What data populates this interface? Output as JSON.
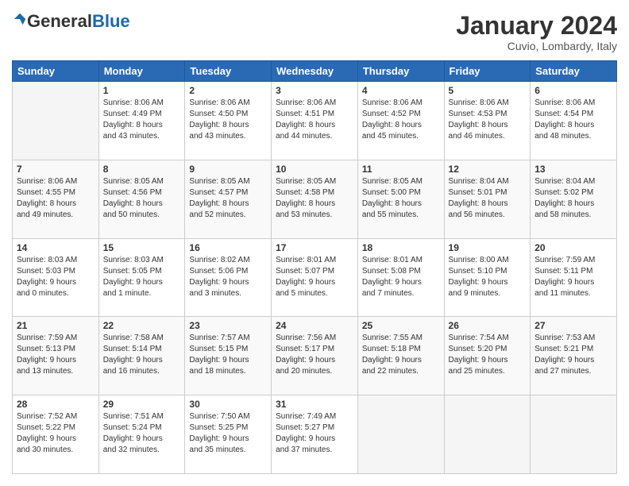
{
  "header": {
    "logo": {
      "general": "General",
      "blue": "Blue"
    },
    "title": "January 2024",
    "location": "Cuvio, Lombardy, Italy"
  },
  "calendar": {
    "headers": [
      "Sunday",
      "Monday",
      "Tuesday",
      "Wednesday",
      "Thursday",
      "Friday",
      "Saturday"
    ],
    "weeks": [
      [
        {
          "day": "",
          "info": ""
        },
        {
          "day": "1",
          "info": "Sunrise: 8:06 AM\nSunset: 4:49 PM\nDaylight: 8 hours\nand 43 minutes."
        },
        {
          "day": "2",
          "info": "Sunrise: 8:06 AM\nSunset: 4:50 PM\nDaylight: 8 hours\nand 43 minutes."
        },
        {
          "day": "3",
          "info": "Sunrise: 8:06 AM\nSunset: 4:51 PM\nDaylight: 8 hours\nand 44 minutes."
        },
        {
          "day": "4",
          "info": "Sunrise: 8:06 AM\nSunset: 4:52 PM\nDaylight: 8 hours\nand 45 minutes."
        },
        {
          "day": "5",
          "info": "Sunrise: 8:06 AM\nSunset: 4:53 PM\nDaylight: 8 hours\nand 46 minutes."
        },
        {
          "day": "6",
          "info": "Sunrise: 8:06 AM\nSunset: 4:54 PM\nDaylight: 8 hours\nand 48 minutes."
        }
      ],
      [
        {
          "day": "7",
          "info": "Sunrise: 8:06 AM\nSunset: 4:55 PM\nDaylight: 8 hours\nand 49 minutes."
        },
        {
          "day": "8",
          "info": "Sunrise: 8:05 AM\nSunset: 4:56 PM\nDaylight: 8 hours\nand 50 minutes."
        },
        {
          "day": "9",
          "info": "Sunrise: 8:05 AM\nSunset: 4:57 PM\nDaylight: 8 hours\nand 52 minutes."
        },
        {
          "day": "10",
          "info": "Sunrise: 8:05 AM\nSunset: 4:58 PM\nDaylight: 8 hours\nand 53 minutes."
        },
        {
          "day": "11",
          "info": "Sunrise: 8:05 AM\nSunset: 5:00 PM\nDaylight: 8 hours\nand 55 minutes."
        },
        {
          "day": "12",
          "info": "Sunrise: 8:04 AM\nSunset: 5:01 PM\nDaylight: 8 hours\nand 56 minutes."
        },
        {
          "day": "13",
          "info": "Sunrise: 8:04 AM\nSunset: 5:02 PM\nDaylight: 8 hours\nand 58 minutes."
        }
      ],
      [
        {
          "day": "14",
          "info": "Sunrise: 8:03 AM\nSunset: 5:03 PM\nDaylight: 9 hours\nand 0 minutes."
        },
        {
          "day": "15",
          "info": "Sunrise: 8:03 AM\nSunset: 5:05 PM\nDaylight: 9 hours\nand 1 minute."
        },
        {
          "day": "16",
          "info": "Sunrise: 8:02 AM\nSunset: 5:06 PM\nDaylight: 9 hours\nand 3 minutes."
        },
        {
          "day": "17",
          "info": "Sunrise: 8:01 AM\nSunset: 5:07 PM\nDaylight: 9 hours\nand 5 minutes."
        },
        {
          "day": "18",
          "info": "Sunrise: 8:01 AM\nSunset: 5:08 PM\nDaylight: 9 hours\nand 7 minutes."
        },
        {
          "day": "19",
          "info": "Sunrise: 8:00 AM\nSunset: 5:10 PM\nDaylight: 9 hours\nand 9 minutes."
        },
        {
          "day": "20",
          "info": "Sunrise: 7:59 AM\nSunset: 5:11 PM\nDaylight: 9 hours\nand 11 minutes."
        }
      ],
      [
        {
          "day": "21",
          "info": "Sunrise: 7:59 AM\nSunset: 5:13 PM\nDaylight: 9 hours\nand 13 minutes."
        },
        {
          "day": "22",
          "info": "Sunrise: 7:58 AM\nSunset: 5:14 PM\nDaylight: 9 hours\nand 16 minutes."
        },
        {
          "day": "23",
          "info": "Sunrise: 7:57 AM\nSunset: 5:15 PM\nDaylight: 9 hours\nand 18 minutes."
        },
        {
          "day": "24",
          "info": "Sunrise: 7:56 AM\nSunset: 5:17 PM\nDaylight: 9 hours\nand 20 minutes."
        },
        {
          "day": "25",
          "info": "Sunrise: 7:55 AM\nSunset: 5:18 PM\nDaylight: 9 hours\nand 22 minutes."
        },
        {
          "day": "26",
          "info": "Sunrise: 7:54 AM\nSunset: 5:20 PM\nDaylight: 9 hours\nand 25 minutes."
        },
        {
          "day": "27",
          "info": "Sunrise: 7:53 AM\nSunset: 5:21 PM\nDaylight: 9 hours\nand 27 minutes."
        }
      ],
      [
        {
          "day": "28",
          "info": "Sunrise: 7:52 AM\nSunset: 5:22 PM\nDaylight: 9 hours\nand 30 minutes."
        },
        {
          "day": "29",
          "info": "Sunrise: 7:51 AM\nSunset: 5:24 PM\nDaylight: 9 hours\nand 32 minutes."
        },
        {
          "day": "30",
          "info": "Sunrise: 7:50 AM\nSunset: 5:25 PM\nDaylight: 9 hours\nand 35 minutes."
        },
        {
          "day": "31",
          "info": "Sunrise: 7:49 AM\nSunset: 5:27 PM\nDaylight: 9 hours\nand 37 minutes."
        },
        {
          "day": "",
          "info": ""
        },
        {
          "day": "",
          "info": ""
        },
        {
          "day": "",
          "info": ""
        }
      ]
    ]
  }
}
